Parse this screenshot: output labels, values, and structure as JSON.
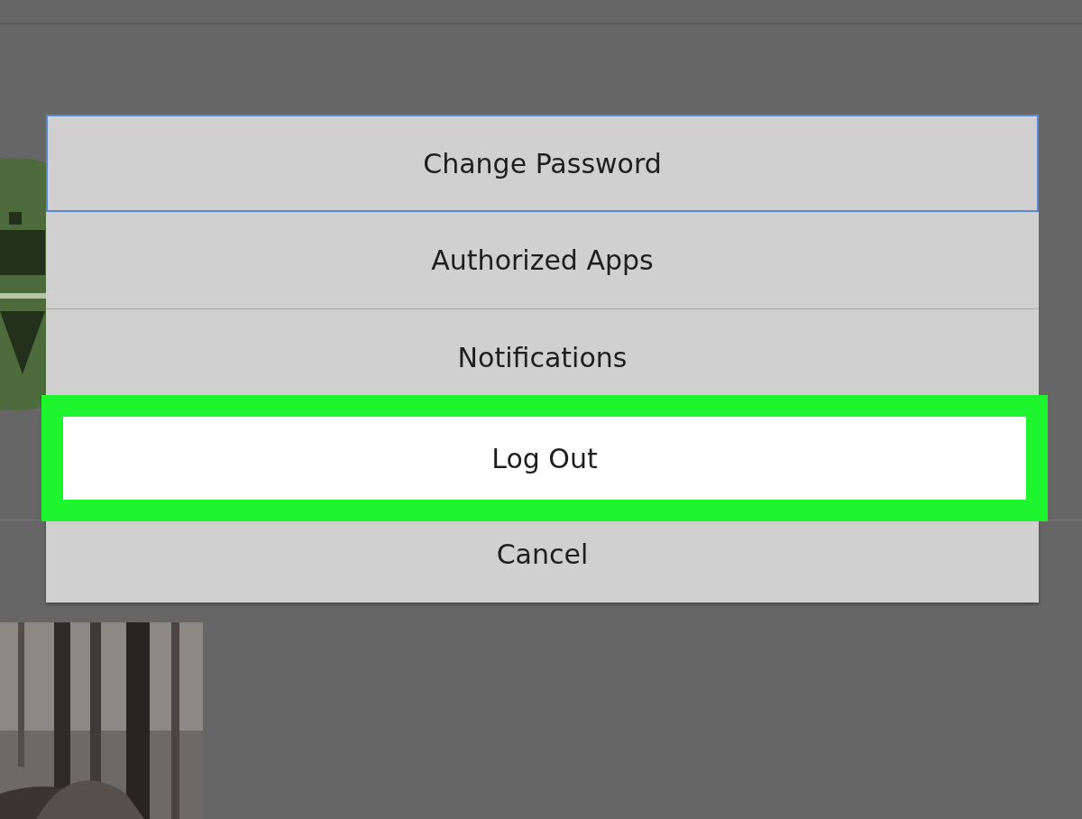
{
  "menu": {
    "items": [
      {
        "label": "Change Password",
        "focused": true,
        "highlighted": false
      },
      {
        "label": "Authorized Apps",
        "focused": false,
        "highlighted": false
      },
      {
        "label": "Notifications",
        "focused": false,
        "highlighted": false
      },
      {
        "label": "Log Out",
        "focused": false,
        "highlighted": true
      },
      {
        "label": "Cancel",
        "focused": false,
        "highlighted": false
      }
    ]
  }
}
